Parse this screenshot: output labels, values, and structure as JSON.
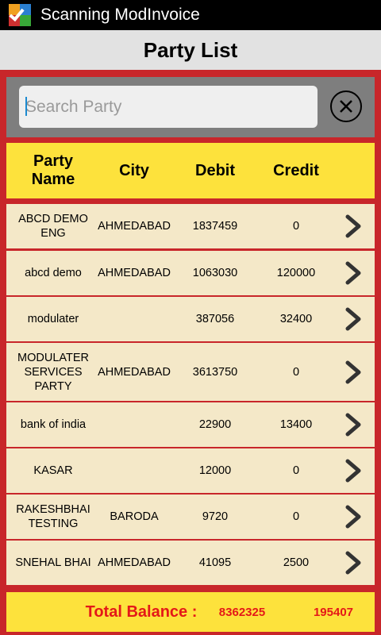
{
  "app": {
    "title": "Scanning ModInvoice",
    "icon": "app-logo-icon"
  },
  "header": {
    "title": "Party List"
  },
  "search": {
    "placeholder": "Search Party",
    "value": "",
    "clear_icon": "close-circle-icon"
  },
  "table": {
    "columns": [
      "Party\nName",
      "City",
      "Debit",
      "Credit"
    ],
    "rows": [
      {
        "name": "ABCD DEMO ENG",
        "city": "AHMEDABAD",
        "debit": "1837459",
        "credit": "0"
      },
      {
        "name": "abcd demo",
        "city": "AHMEDABAD",
        "debit": "1063030",
        "credit": "120000"
      },
      {
        "name": "modulater",
        "city": "",
        "debit": "387056",
        "credit": "32400"
      },
      {
        "name": "MODULATER SERVICES PARTY",
        "city": "AHMEDABAD",
        "debit": "3613750",
        "credit": "0"
      },
      {
        "name": "bank of india",
        "city": "",
        "debit": "22900",
        "credit": "13400"
      },
      {
        "name": "KASAR",
        "city": "",
        "debit": "12000",
        "credit": "0"
      },
      {
        "name": "RAKESHBHAI TESTING",
        "city": "BARODA",
        "debit": "9720",
        "credit": "0"
      },
      {
        "name": "SNEHAL BHAI",
        "city": "AHMEDABAD",
        "debit": "41095",
        "credit": "2500"
      }
    ],
    "row_icon": "chevron-right-icon"
  },
  "footer": {
    "label": "Total Balance :",
    "debit_total": "8362325",
    "credit_total": "195407"
  },
  "colors": {
    "background": "#c8262a",
    "header_yellow": "#fde23c",
    "row_bg": "#f4e8c8",
    "total_text": "#e41818"
  }
}
